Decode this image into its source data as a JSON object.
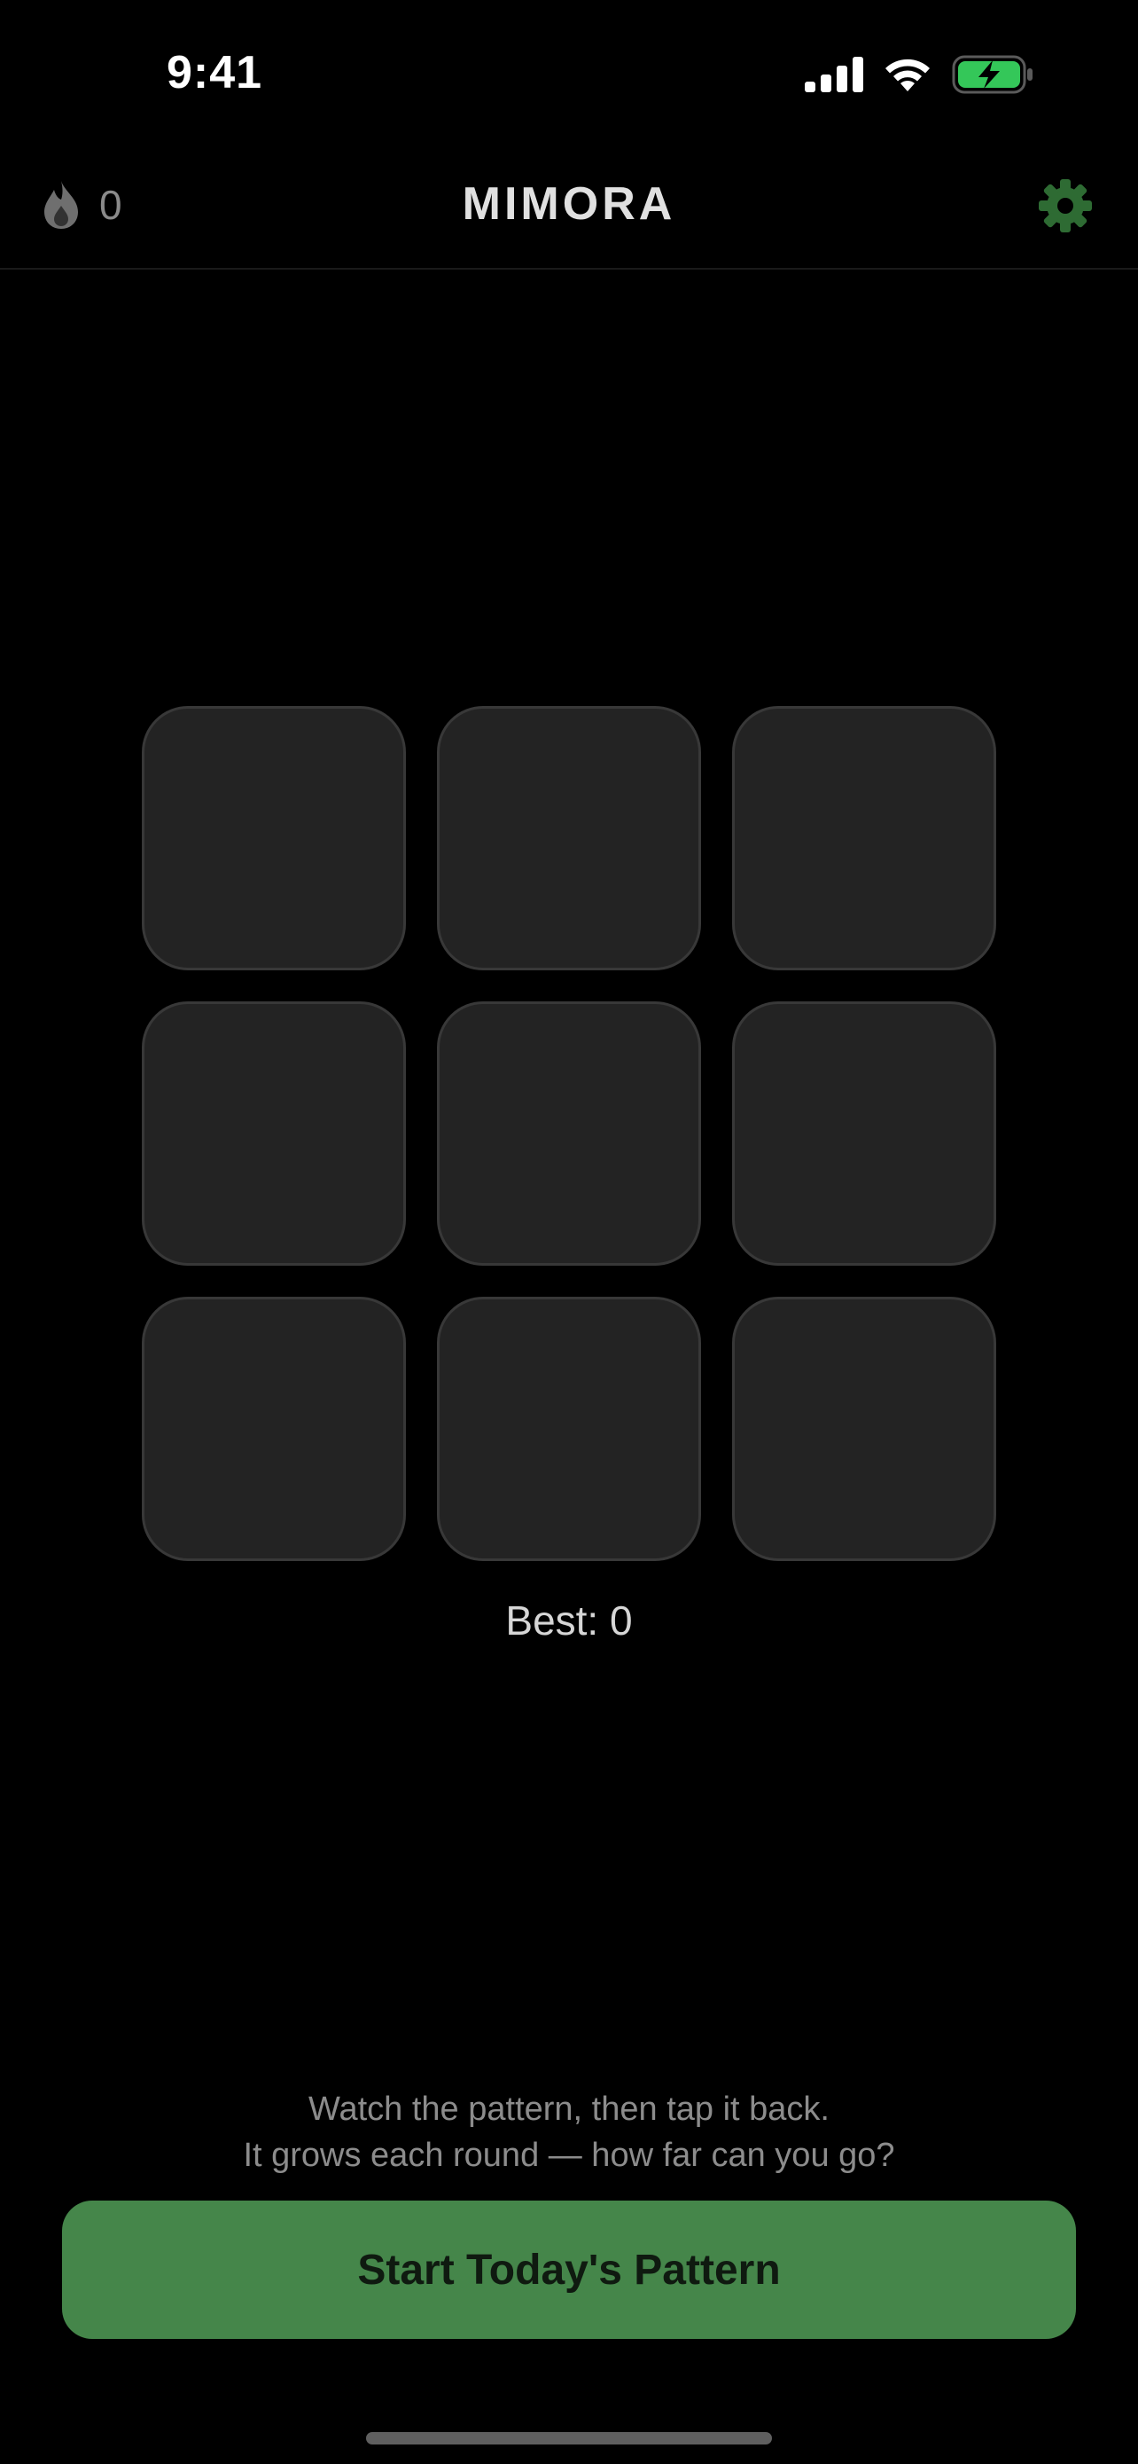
{
  "status_bar": {
    "time": "9:41"
  },
  "header": {
    "streak_count": "0",
    "title": "MIMORA",
    "settings_icon": "gear-icon",
    "streak_icon": "flame-icon"
  },
  "grid": {
    "tiles": [
      "",
      "",
      "",
      "",
      "",
      "",
      "",
      "",
      ""
    ]
  },
  "best": "Best: 0",
  "instructions": {
    "line1": "Watch the pattern, then tap it back.",
    "line2": "It grows each round — how far can you go?"
  },
  "start_button": {
    "label": "Start Today's Pattern"
  },
  "colors": {
    "accent": "#45864a",
    "battery": "#34c759",
    "tile": "#232323",
    "background": "#000000"
  }
}
